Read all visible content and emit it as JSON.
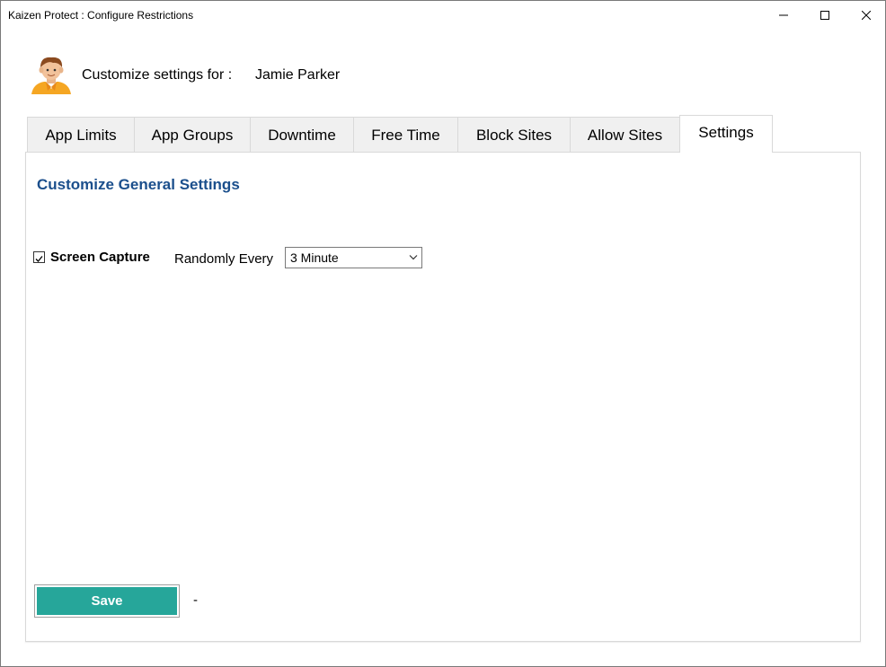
{
  "window": {
    "title": "Kaizen Protect : Configure Restrictions"
  },
  "header": {
    "customize_label": "Customize settings for :",
    "user_name": "Jamie Parker"
  },
  "tabs": [
    {
      "label": "App Limits",
      "active": false
    },
    {
      "label": "App Groups",
      "active": false
    },
    {
      "label": "Downtime",
      "active": false
    },
    {
      "label": "Free Time",
      "active": false
    },
    {
      "label": "Block Sites",
      "active": false
    },
    {
      "label": "Allow Sites",
      "active": false
    },
    {
      "label": "Settings",
      "active": true
    }
  ],
  "settings": {
    "section_title": "Customize General Settings",
    "screen_capture": {
      "label": "Screen Capture",
      "checked": true,
      "randomly_label": "Randomly Every",
      "interval_value": "3 Minute"
    },
    "save_label": "Save",
    "status_text": "-"
  },
  "colors": {
    "accent_title": "#1b4f8c",
    "save_button": "#26a69a"
  }
}
